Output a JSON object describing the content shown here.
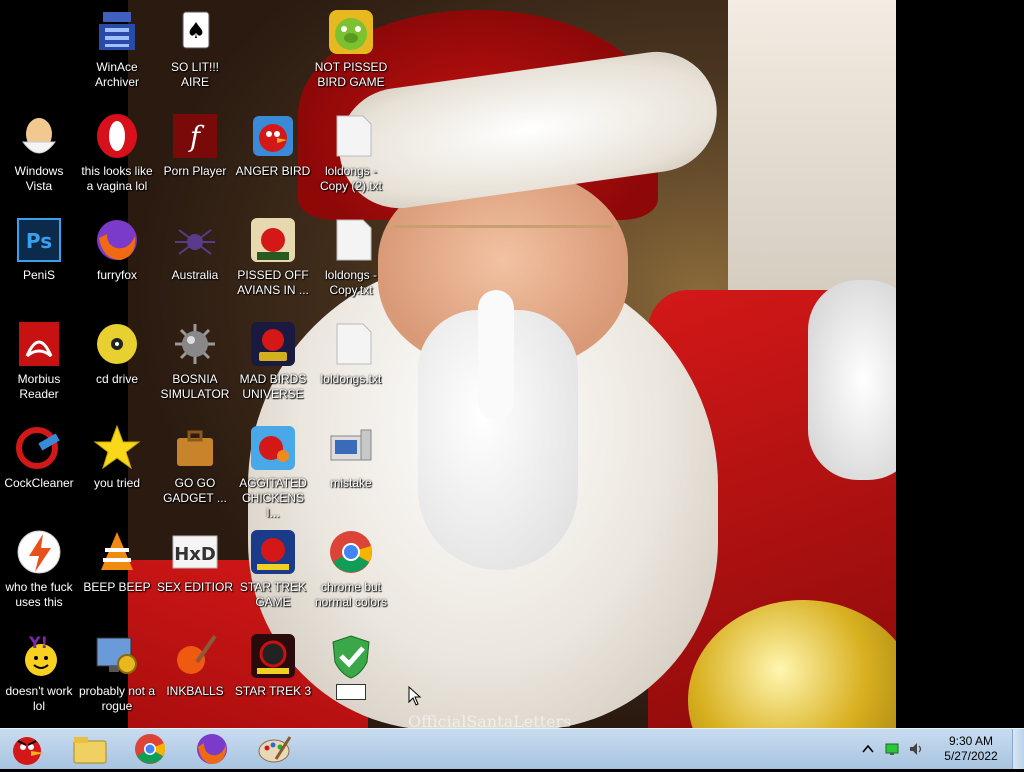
{
  "desktop": {
    "icons": [
      {
        "label": "WinAce Archiver",
        "icon": "winace-icon"
      },
      {
        "label": "SO LIT!!! AIRE",
        "icon": "solitaire-icon"
      },
      {
        "label": "NOT PISSED BIRD GAME",
        "icon": "green-pig-icon"
      },
      {
        "label": "Windows Vista",
        "icon": "egg-icon"
      },
      {
        "label": "this looks like a vagina lol",
        "icon": "opera-icon"
      },
      {
        "label": "Porn Player",
        "icon": "flash-icon"
      },
      {
        "label": "ANGER BIRD",
        "icon": "angry-bird-icon"
      },
      {
        "label": "loldongs - Copy (2).txt",
        "icon": "text-file-icon"
      },
      {
        "label": "PeniS",
        "icon": "photoshop-icon"
      },
      {
        "label": "furryfox",
        "icon": "firefox-icon"
      },
      {
        "label": "Australia",
        "icon": "spider-icon"
      },
      {
        "label": "PISSED OFF AVIANS IN ...",
        "icon": "angry-birds-seasons-icon"
      },
      {
        "label": "loldongs - Copy.txt",
        "icon": "text-file-icon"
      },
      {
        "label": "Morbius Reader",
        "icon": "acrobat-icon"
      },
      {
        "label": "cd drive",
        "icon": "cd-icon"
      },
      {
        "label": "BOSNIA SIMULATOR",
        "icon": "mine-icon"
      },
      {
        "label": "MAD BIRDS UNIVERSE",
        "icon": "angry-birds-space-icon"
      },
      {
        "label": "loldongs.txt",
        "icon": "text-file-icon"
      },
      {
        "label": "CockCleaner",
        "icon": "ccleaner-icon"
      },
      {
        "label": "you tried",
        "icon": "star-icon"
      },
      {
        "label": "GO GO GADGET ...",
        "icon": "briefcase-icon"
      },
      {
        "label": "AGGITATED CHICKENS I...",
        "icon": "angry-birds-rio-icon"
      },
      {
        "label": "mistake",
        "icon": "computer-tools-icon"
      },
      {
        "label": "who the fuck uses this",
        "icon": "flash-bolt-icon"
      },
      {
        "label": "BEEP BEEP",
        "icon": "vlc-icon"
      },
      {
        "label": "SEX EDITIOR",
        "icon": "hxd-icon"
      },
      {
        "label": "STAR TREK GAME",
        "icon": "angry-birds-star-wars-icon"
      },
      {
        "label": "chrome but normal colors",
        "icon": "chrome-icon"
      },
      {
        "label": "doesn't work lol",
        "icon": "yahoo-messenger-icon"
      },
      {
        "label": "probably not a rogue",
        "icon": "monitor-gear-icon"
      },
      {
        "label": "INKBALLS",
        "icon": "inkball-icon"
      },
      {
        "label": "STAR TREK 3",
        "icon": "angry-birds-star-wars-2-icon"
      },
      {
        "label": "",
        "icon": "shield-check-icon"
      }
    ],
    "wallpaper_watermark": "OfficialSantaLetters"
  },
  "taskbar": {
    "pinned": [
      {
        "icon": "angry-bird-start-icon"
      },
      {
        "icon": "folder-explorer-icon"
      },
      {
        "icon": "chrome-icon"
      },
      {
        "icon": "firefox-icon"
      },
      {
        "icon": "paint-icon"
      }
    ],
    "tray": {
      "time": "9:30 AM",
      "date": "5/27/2022"
    }
  },
  "colors": {
    "taskbar_top": "#c8dcf0",
    "taskbar_bottom": "#a8c4e0",
    "label_text": "#ffffff"
  }
}
